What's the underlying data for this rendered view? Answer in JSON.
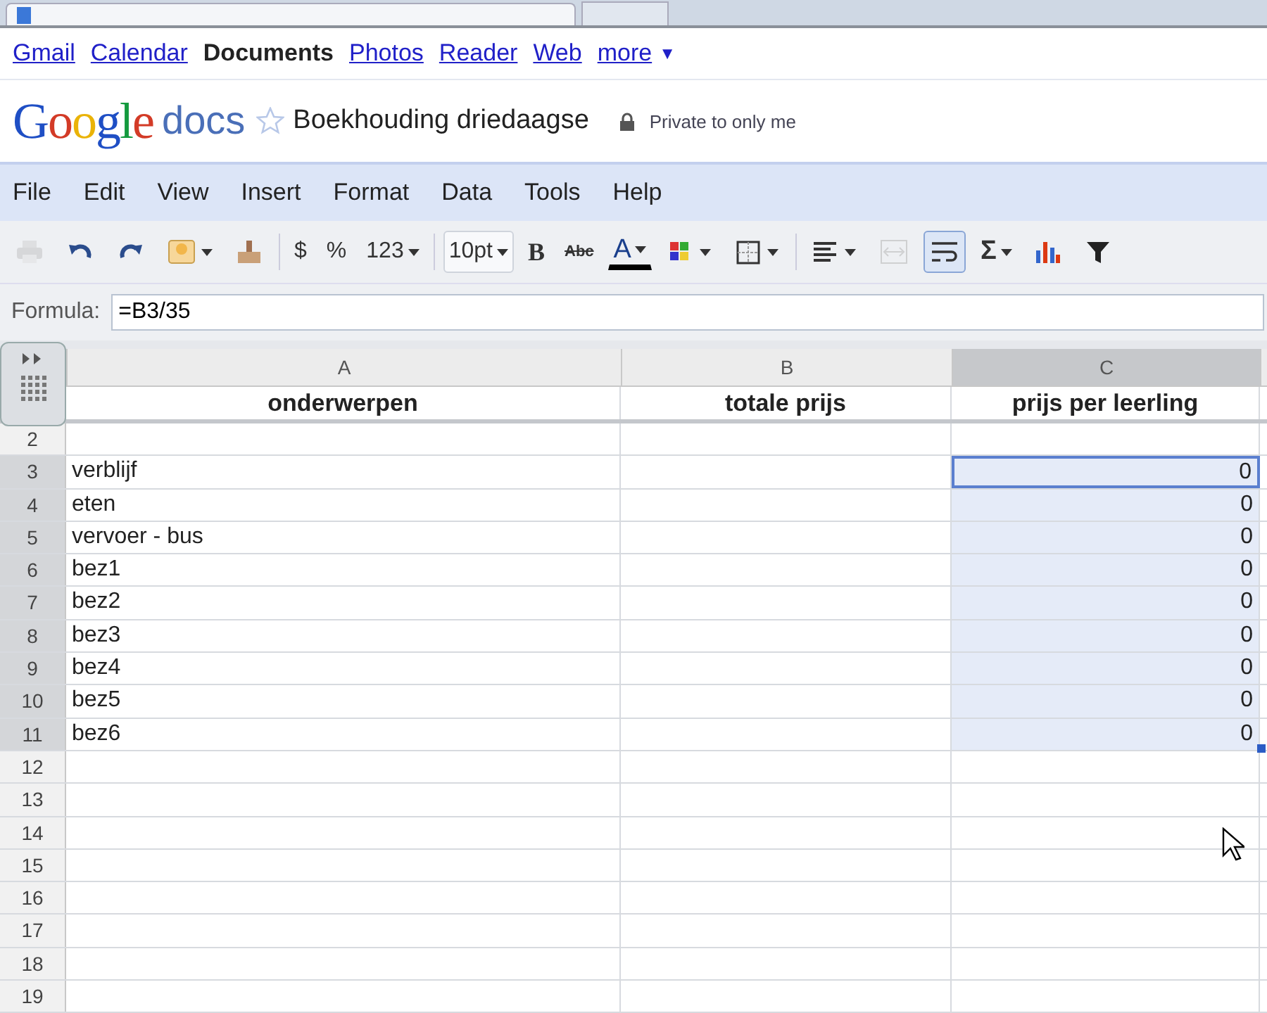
{
  "google_bar": {
    "links": [
      {
        "label": "Gmail",
        "selected": false
      },
      {
        "label": "Calendar",
        "selected": false
      },
      {
        "label": "Documents",
        "selected": true
      },
      {
        "label": "Photos",
        "selected": false
      },
      {
        "label": "Reader",
        "selected": false
      },
      {
        "label": "Web",
        "selected": false
      },
      {
        "label": "more",
        "selected": false
      }
    ],
    "more_caret": "▼"
  },
  "header": {
    "logo": "Google",
    "product": "docs",
    "starred": false,
    "title": "Boekhouding driedaagse",
    "privacy": "Private to only me"
  },
  "menu": [
    "File",
    "Edit",
    "View",
    "Insert",
    "Format",
    "Data",
    "Tools",
    "Help"
  ],
  "toolbar": [
    {
      "kind": "print",
      "disabled": true,
      "selected": false
    },
    {
      "kind": "undo",
      "disabled": false,
      "selected": false
    },
    {
      "kind": "redo",
      "disabled": false,
      "selected": false
    },
    {
      "kind": "image",
      "disabled": false,
      "selected": false
    },
    {
      "kind": "roller",
      "disabled": false,
      "selected": false
    },
    {
      "kind": "text",
      "label": "$",
      "disabled": false,
      "selected": false
    },
    {
      "kind": "text",
      "label": "%",
      "disabled": false,
      "selected": false
    },
    {
      "kind": "dropdown",
      "label": "123",
      "disabled": false,
      "selected": false
    },
    {
      "kind": "boxed",
      "label": "10pt",
      "disabled": false,
      "selected": false
    },
    {
      "kind": "bold",
      "label": "B",
      "disabled": false,
      "selected": false
    },
    {
      "kind": "strike",
      "label": "Abc",
      "disabled": false,
      "selected": false
    },
    {
      "kind": "color",
      "label": "A",
      "disabled": false,
      "selected": false
    },
    {
      "kind": "fill",
      "disabled": false,
      "selected": false
    },
    {
      "kind": "borders",
      "disabled": false,
      "selected": false
    },
    {
      "kind": "align",
      "disabled": false,
      "selected": false
    },
    {
      "kind": "merge",
      "disabled": true,
      "selected": false
    },
    {
      "kind": "wrap",
      "disabled": false,
      "selected": true
    },
    {
      "kind": "sum",
      "label": "Σ",
      "disabled": false,
      "selected": false
    },
    {
      "kind": "chart",
      "disabled": false,
      "selected": false
    },
    {
      "kind": "filter",
      "disabled": false,
      "selected": false
    }
  ],
  "formula_bar": {
    "label": "Formula:",
    "value": "=B3/35"
  },
  "sheet": {
    "columns": [
      {
        "label": "A",
        "selected": false
      },
      {
        "label": "B",
        "selected": false
      },
      {
        "label": "C",
        "selected": true
      }
    ],
    "rows": [
      {
        "kind": "header",
        "selected": false,
        "active": false,
        "cells": [
          "onderwerpen",
          "totale prijs",
          "prijs per leerling"
        ]
      },
      {
        "number": "2",
        "kind": "data",
        "selected": false,
        "active": false
      },
      {
        "number": "3",
        "kind": "data",
        "selected": true,
        "active": true,
        "cells": [
          "verblijf",
          "",
          "0"
        ]
      },
      {
        "number": "4",
        "kind": "data",
        "selected": true,
        "active": false,
        "cells": [
          "eten",
          "",
          "0"
        ]
      },
      {
        "number": "5",
        "kind": "data",
        "selected": true,
        "active": false,
        "cells": [
          "vervoer - bus",
          "",
          "0"
        ]
      },
      {
        "number": "6",
        "kind": "data",
        "selected": true,
        "active": false,
        "cells": [
          "bez1",
          "",
          "0"
        ]
      },
      {
        "number": "7",
        "kind": "data",
        "selected": true,
        "active": false,
        "cells": [
          "bez2",
          "",
          "0"
        ]
      },
      {
        "number": "8",
        "kind": "data",
        "selected": true,
        "active": false,
        "cells": [
          "bez3",
          "",
          "0"
        ]
      },
      {
        "number": "9",
        "kind": "data",
        "selected": true,
        "active": false,
        "cells": [
          "bez4",
          "",
          "0"
        ]
      },
      {
        "number": "10",
        "kind": "data",
        "selected": true,
        "active": false,
        "cells": [
          "bez5",
          "",
          "0"
        ]
      },
      {
        "number": "11",
        "kind": "data",
        "selected": true,
        "active": false,
        "cells": [
          "bez6",
          "",
          "0"
        ]
      },
      {
        "number": "12",
        "kind": "data",
        "selected": false,
        "active": false
      },
      {
        "number": "13",
        "kind": "data",
        "selected": false,
        "active": false
      },
      {
        "number": "14",
        "kind": "data",
        "selected": false,
        "active": false
      },
      {
        "number": "15",
        "kind": "data",
        "selected": false,
        "active": false
      },
      {
        "number": "16",
        "kind": "data",
        "selected": false,
        "active": false
      },
      {
        "number": "17",
        "kind": "data",
        "selected": false,
        "active": false
      },
      {
        "number": "18",
        "kind": "data",
        "selected": false,
        "active": false
      },
      {
        "number": "19",
        "kind": "data",
        "selected": false,
        "active": false
      }
    ]
  }
}
